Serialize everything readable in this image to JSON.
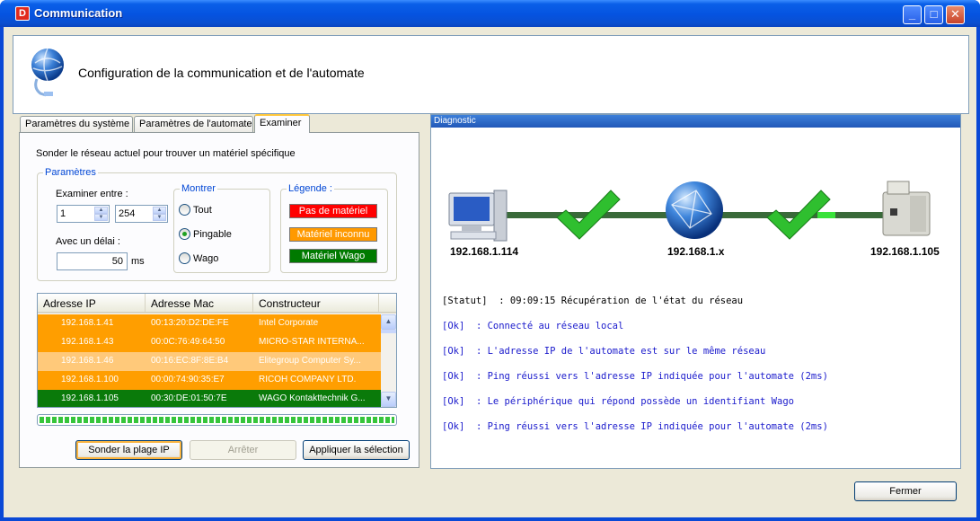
{
  "window": {
    "title": "Communication",
    "app_icon": "D",
    "minimize_glyph": "_",
    "maximize_glyph": "□",
    "close_glyph": "✕"
  },
  "header": {
    "title": "Configuration de la communication et de l'automate",
    "icon": "globe-network-icon"
  },
  "tabs": [
    {
      "label": "Paramètres du système",
      "active": false
    },
    {
      "label": "Paramètres de l'automate",
      "active": false
    },
    {
      "label": "Examiner",
      "active": true
    }
  ],
  "examiner": {
    "description": "Sonder le réseau actuel pour trouver un matériel spécifique",
    "params_legend": "Paramètres",
    "range_label": "Examiner entre :",
    "range_start": "1",
    "range_end": "254",
    "delay_label": "Avec un délai :",
    "delay_value": "50",
    "delay_unit": "ms",
    "show_legend": "Montrer",
    "show_options": [
      {
        "label": "Tout",
        "selected": false
      },
      {
        "label": "Pingable",
        "selected": true
      },
      {
        "label": "Wago",
        "selected": false
      }
    ],
    "legend_legend": "Légende :",
    "legend_items": [
      {
        "label": "Pas de matériel",
        "color": "#ff0000"
      },
      {
        "label": "Matériel inconnu",
        "color": "#ff9900"
      },
      {
        "label": "Matériel Wago",
        "color": "#007a00"
      }
    ],
    "list": {
      "columns": [
        "Adresse IP",
        "Adresse Mac",
        "Constructeur"
      ],
      "rows": [
        {
          "ip": "192.168.1.41",
          "mac": "00:13:20:D2:DE:FE",
          "vendor": "Intel Corporate",
          "color": "#ff9e00"
        },
        {
          "ip": "192.168.1.43",
          "mac": "00:0C:76:49:64:50",
          "vendor": "MICRO-STAR INTERNA...",
          "color": "#ff9e00"
        },
        {
          "ip": "192.168.1.46",
          "mac": "00:16:EC:8F:8E:B4",
          "vendor": "Elitegroup Computer Sy...",
          "color": "#ffc97a"
        },
        {
          "ip": "192.168.1.100",
          "mac": "00:00:74:90:35:E7",
          "vendor": "RICOH COMPANY LTD.",
          "color": "#ff9e00"
        },
        {
          "ip": "192.168.1.105",
          "mac": "00:30:DE:01:50:7E",
          "vendor": "WAGO Kontakttechnik G...",
          "color": "#0a7a0a"
        }
      ]
    },
    "progress_fraction": 1.0,
    "buttons": {
      "scan": "Sonder la plage IP",
      "stop": "Arrêter",
      "apply": "Appliquer la sélection"
    }
  },
  "diagnostic": {
    "title": "Diagnostic",
    "nodes": [
      {
        "label": "192.168.1.114",
        "icon": "computer-icon"
      },
      {
        "label": "192.168.1.x",
        "icon": "network-globe-icon"
      },
      {
        "label": "192.168.1.105",
        "icon": "plc-device-icon"
      }
    ],
    "status_tag": "[Statut]",
    "status_text": ": 09:09:15 Récupération de l'état du réseau",
    "log": [
      {
        "tag": "[Ok]",
        "text": ": Connecté au réseau local"
      },
      {
        "tag": "[Ok]",
        "text": ": L'adresse IP de l'automate est sur le même réseau"
      },
      {
        "tag": "[Ok]",
        "text": ": Ping réussi vers l'adresse IP indiquée pour l'automate (2ms)"
      },
      {
        "tag": "[Ok]",
        "text": ": Le périphérique qui répond possède un identifiant Wago"
      },
      {
        "tag": "[Ok]",
        "text": ": Ping réussi vers l'adresse IP indiquée pour l'automate (2ms)"
      }
    ],
    "link_color": "#3a6a3a",
    "check_color": "#2fbf2f"
  },
  "footer": {
    "close_label": "Fermer"
  }
}
